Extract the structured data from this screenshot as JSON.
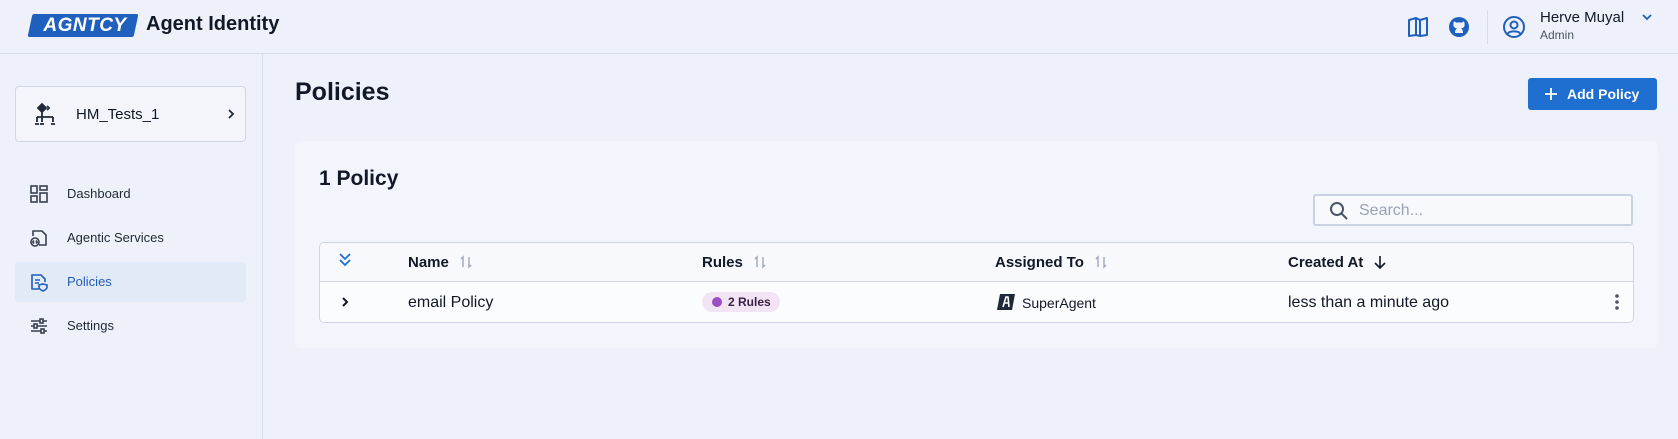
{
  "header": {
    "logo_text": "AGNTCY",
    "app_title": "Agent Identity",
    "icons": [
      "docs-book-icon",
      "github-icon"
    ],
    "user": {
      "name": "Herve Muyal",
      "role": "Admin"
    }
  },
  "sidebar": {
    "org_selector": {
      "name": "HM_Tests_1"
    },
    "items": [
      {
        "label": "Dashboard",
        "icon": "dashboard-grid-icon",
        "active": false
      },
      {
        "label": "Agentic Services",
        "icon": "code-file-icon",
        "active": false
      },
      {
        "label": "Policies",
        "icon": "policy-document-icon",
        "active": true
      },
      {
        "label": "Settings",
        "icon": "sliders-icon",
        "active": false
      }
    ]
  },
  "main": {
    "title": "Policies",
    "add_button": "Add Policy",
    "count_label": "1 Policy",
    "search": {
      "placeholder": "Search...",
      "value": ""
    },
    "table": {
      "columns": [
        "Name",
        "Rules",
        "Assigned To",
        "Created At"
      ],
      "sort": {
        "column": "Created At",
        "direction": "desc"
      },
      "rows": [
        {
          "name": "email Policy",
          "rules": "2 Rules",
          "assigned_to": "SuperAgent",
          "created_at": "less than a minute ago"
        }
      ]
    }
  },
  "colors": {
    "accent": "#1f6fd1",
    "brand": "#1f5fbd",
    "background": "#eef1f9",
    "rules_badge_bg": "#f2e3f5",
    "rules_badge_dot": "#9a4fc4"
  }
}
